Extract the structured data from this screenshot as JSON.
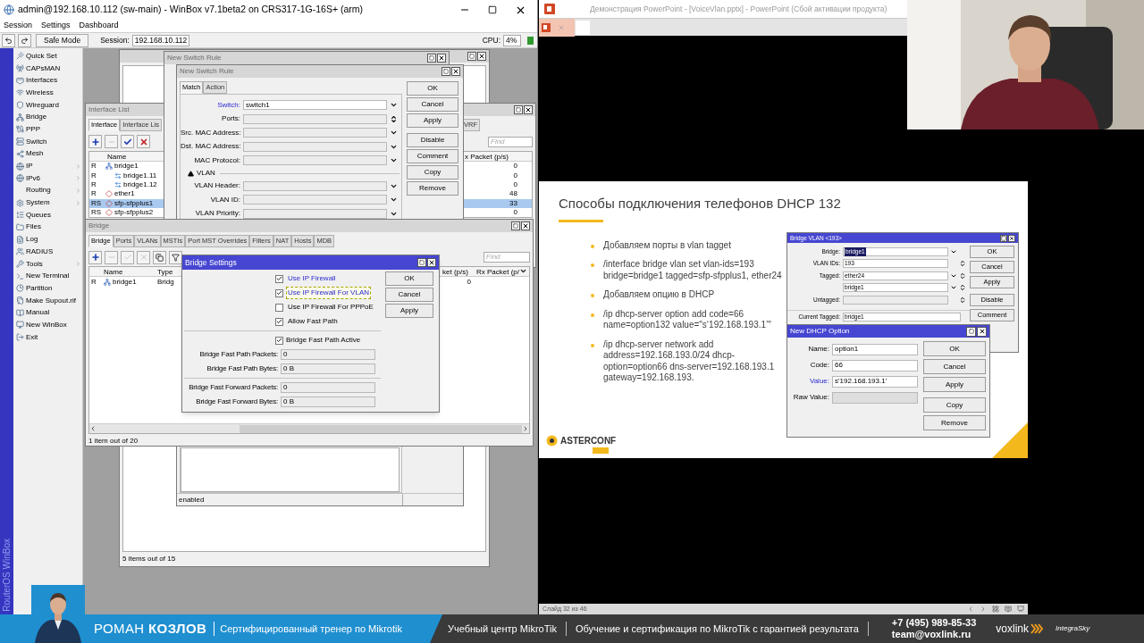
{
  "winbox": {
    "title": "admin@192.168.10.112 (sw-main) - WinBox v7.1beta2 on CRS317-1G-16S+ (arm)",
    "menu": [
      "Session",
      "Settings",
      "Dashboard"
    ],
    "safe_mode": "Safe Mode",
    "session_label": "Session:",
    "session": "192.168.10.112",
    "cpu_label": "CPU:",
    "cpu": "4%",
    "side_label": "RouterOS WinBox",
    "sidebar": [
      {
        "label": "Quick Set",
        "submenu": false
      },
      {
        "label": "CAPsMAN",
        "submenu": false
      },
      {
        "label": "Interfaces",
        "submenu": false
      },
      {
        "label": "Wireless",
        "submenu": false
      },
      {
        "label": "Wireguard",
        "submenu": false
      },
      {
        "label": "Bridge",
        "submenu": false
      },
      {
        "label": "PPP",
        "submenu": false
      },
      {
        "label": "Switch",
        "submenu": false
      },
      {
        "label": "Mesh",
        "submenu": false
      },
      {
        "label": "IP",
        "submenu": true
      },
      {
        "label": "IPv6",
        "submenu": true
      },
      {
        "label": "Routing",
        "submenu": true
      },
      {
        "label": "System",
        "submenu": true
      },
      {
        "label": "Queues",
        "submenu": false
      },
      {
        "label": "Files",
        "submenu": false
      },
      {
        "label": "Log",
        "submenu": false
      },
      {
        "label": "RADIUS",
        "submenu": false
      },
      {
        "label": "Tools",
        "submenu": true
      },
      {
        "label": "New Terminal",
        "submenu": false
      },
      {
        "label": "Partition",
        "submenu": false
      },
      {
        "label": "Make Supout.rif",
        "submenu": false
      },
      {
        "label": "Manual",
        "submenu": false
      },
      {
        "label": "New WinBox",
        "submenu": false
      },
      {
        "label": "Exit",
        "submenu": false
      }
    ],
    "item_list": {
      "active": false,
      "status": "5 items out of 15"
    },
    "switch_rule_back": {
      "title": "New Switch Rule",
      "active": false
    },
    "interface_list": {
      "title": "Interface List",
      "active": false,
      "tabs": [
        {
          "label": "Interface",
          "selected": true
        },
        {
          "label": "Interface Lis",
          "selected": false
        }
      ],
      "right_tab": {
        "label": "VRF",
        "selected": false
      },
      "find_placeholder": "Find",
      "name_column": "Name",
      "tx_column": "x Packet (p/s)",
      "rows": [
        {
          "flags": "R",
          "name": "bridge1",
          "kind": "bridge",
          "tx": "0",
          "selected": false,
          "children": [
            {
              "flags": "R",
              "name": "bridge1.11",
              "kind": "vlan",
              "tx": "0",
              "selected": false
            },
            {
              "flags": "R",
              "name": "bridge1.12",
              "kind": "vlan",
              "tx": "0",
              "selected": false
            }
          ]
        },
        {
          "flags": "R",
          "name": "ether1",
          "kind": "ethernet",
          "tx": "48",
          "selected": false
        },
        {
          "flags": "RS",
          "name": "sfp-sfpplus1",
          "kind": "ethernet",
          "tx": "33",
          "selected": true
        },
        {
          "flags": "RS",
          "name": "sfp-sfpplus2",
          "kind": "ethernet",
          "tx": "0",
          "selected": false
        }
      ]
    },
    "switch_rule": {
      "title": "New Switch Rule",
      "active": false,
      "tabs": [
        {
          "label": "Match",
          "selected": true
        },
        {
          "label": "Action",
          "selected": false
        }
      ],
      "fields": [
        {
          "kind": "dropdown",
          "label": "Switch:",
          "value": "switch1",
          "highlight": true
        },
        {
          "kind": "updown",
          "label": "Ports:",
          "highlight": false
        },
        {
          "kind": "dropdown",
          "label": "Src. MAC Address:",
          "highlight": false
        },
        {
          "kind": "dropdown",
          "label": "Dst. MAC Address:",
          "highlight": false
        },
        {
          "kind": "dropdown",
          "label": "MAC Protocol:",
          "highlight": false
        },
        {
          "kind": "section",
          "label": "VLAN",
          "expanded": true
        },
        {
          "kind": "dropdown",
          "label": "VLAN Header:",
          "highlight": false
        },
        {
          "kind": "dropdown",
          "label": "VLAN ID:",
          "highlight": false
        },
        {
          "kind": "dropdown",
          "label": "VLAN Priority:",
          "highlight": false
        }
      ],
      "buttons": [
        "OK",
        "Cancel",
        "Apply",
        "Disable",
        "Comment",
        "Copy",
        "Remove"
      ],
      "status": "enabled"
    },
    "bridge": {
      "title": "Bridge",
      "active": false,
      "tabs": [
        {
          "label": "Bridge",
          "selected": true
        },
        {
          "label": "Ports",
          "selected": false
        },
        {
          "label": "VLANs",
          "selected": false
        },
        {
          "label": "MSTIs",
          "selected": false
        },
        {
          "label": "Port MST Overrides",
          "selected": false
        },
        {
          "label": "Filters",
          "selected": false
        },
        {
          "label": "NAT",
          "selected": false
        },
        {
          "label": "Hosts",
          "selected": false
        },
        {
          "label": "MDB",
          "selected": false
        }
      ],
      "find_placeholder": "Find",
      "columns_left": [
        "Name",
        "Type"
      ],
      "columns_right": [
        "ket (p/s)",
        "Rx Packet (p/"
      ],
      "rows": [
        {
          "flags": "R",
          "name": "bridge1",
          "type": "Bridg",
          "tx": "0",
          "selected": false
        }
      ],
      "status": "1 item out of 20"
    },
    "bridge_settings": {
      "title": "Bridge Settings",
      "active": true,
      "checks": [
        {
          "label": "Use IP Firewall",
          "checked": true,
          "highlight": true,
          "focused": false
        },
        {
          "label": "Use IP Firewall For VLAN",
          "checked": true,
          "highlight": true,
          "focused": true
        },
        {
          "label": "Use IP Firewall For PPPoE",
          "checked": false,
          "highlight": false,
          "focused": false
        },
        {
          "label": "Allow Fast Path",
          "checked": true,
          "highlight": false,
          "focused": false
        }
      ],
      "fast_path_active": {
        "label": "Bridge Fast Path Active",
        "checked": true
      },
      "field_groups": [
        [
          {
            "label": "Bridge Fast Path Packets:",
            "value": "0"
          },
          {
            "label": "Bridge Fast Path Bytes:",
            "value": "0 B"
          }
        ],
        [
          {
            "label": "Bridge Fast Forward Packets:",
            "value": "0"
          },
          {
            "label": "Bridge Fast Forward Bytes:",
            "value": "0 B"
          }
        ]
      ],
      "buttons": [
        "OK",
        "Cancel",
        "Apply"
      ]
    }
  },
  "powerpoint": {
    "title": "Демонстрация PowerPoint - [VoiceVlan.pptx] - PowerPoint (Сбой активации продукта)",
    "status": "Слайд 32 из 46",
    "slide": {
      "title": "Способы подключения телефонов DHCP 132",
      "bullets": [
        "Добавляем порты в vlan tagget",
        "/interface bridge vlan set vlan-ids=193 bridge=bridge1 tagged=sfp-sfpplus1, ether24",
        "Добавляем опцию в DHCP",
        "/ip dhcp-server option add code=66 name=option132 value=\"s‘192.168.193.1’\"",
        "/ip dhcp-server network add address=192.168.193.0/24 dhcp-option=option66 dns-server=192.168.193.1 gateway=192.168.193."
      ],
      "logo": "ASTERCONF",
      "bridge_vlan": {
        "title": "Bridge VLAN <193>",
        "active": true,
        "fields": [
          {
            "label": "Bridge:",
            "value": "bridge1",
            "selected": true,
            "kind": "dropdown"
          },
          {
            "label": "VLAN IDs:",
            "value": "193",
            "selected": false,
            "kind": "updown"
          },
          {
            "label": "Tagged:",
            "value": "ether24",
            "selected": false,
            "kind": "both"
          },
          {
            "value": "bridge1",
            "selected": false,
            "kind": "both"
          },
          {
            "label": "Untagged:",
            "selected": false,
            "kind": "updown"
          },
          {
            "label": "Current Tagged:",
            "value": "bridge1",
            "selected": false,
            "kind": "readonly"
          }
        ],
        "buttons": [
          "OK",
          "Cancel",
          "Apply",
          "Disable",
          "Comment"
        ]
      },
      "dhcp_option": {
        "title": "New DHCP Option",
        "active": true,
        "fields": [
          {
            "label": "Name:",
            "value": "option1",
            "highlight": false,
            "disabled": false
          },
          {
            "label": "Code:",
            "value": "66",
            "highlight": false,
            "disabled": false
          },
          {
            "label": "Value:",
            "value": "s'192.168.193.1'",
            "highlight": true,
            "disabled": false
          },
          {
            "label": "Raw Value:",
            "highlight": false,
            "disabled": true
          }
        ],
        "buttons": [
          "OK",
          "Cancel",
          "Apply",
          "Copy",
          "Remove"
        ]
      }
    }
  },
  "banner": {
    "name": "РОМАН **КОЗЛОВ**",
    "role": "Сертифицированный тренер по Mikrotik",
    "center": "Учебный центр MikroTik",
    "tagline": "Обучение и сертификация по MikroTik с гарантией результата",
    "phone": "+7 (495) 989-85-33",
    "email": "team@voxlink.ru",
    "logos": [
      "voxlink",
      "IntegraSky"
    ]
  }
}
